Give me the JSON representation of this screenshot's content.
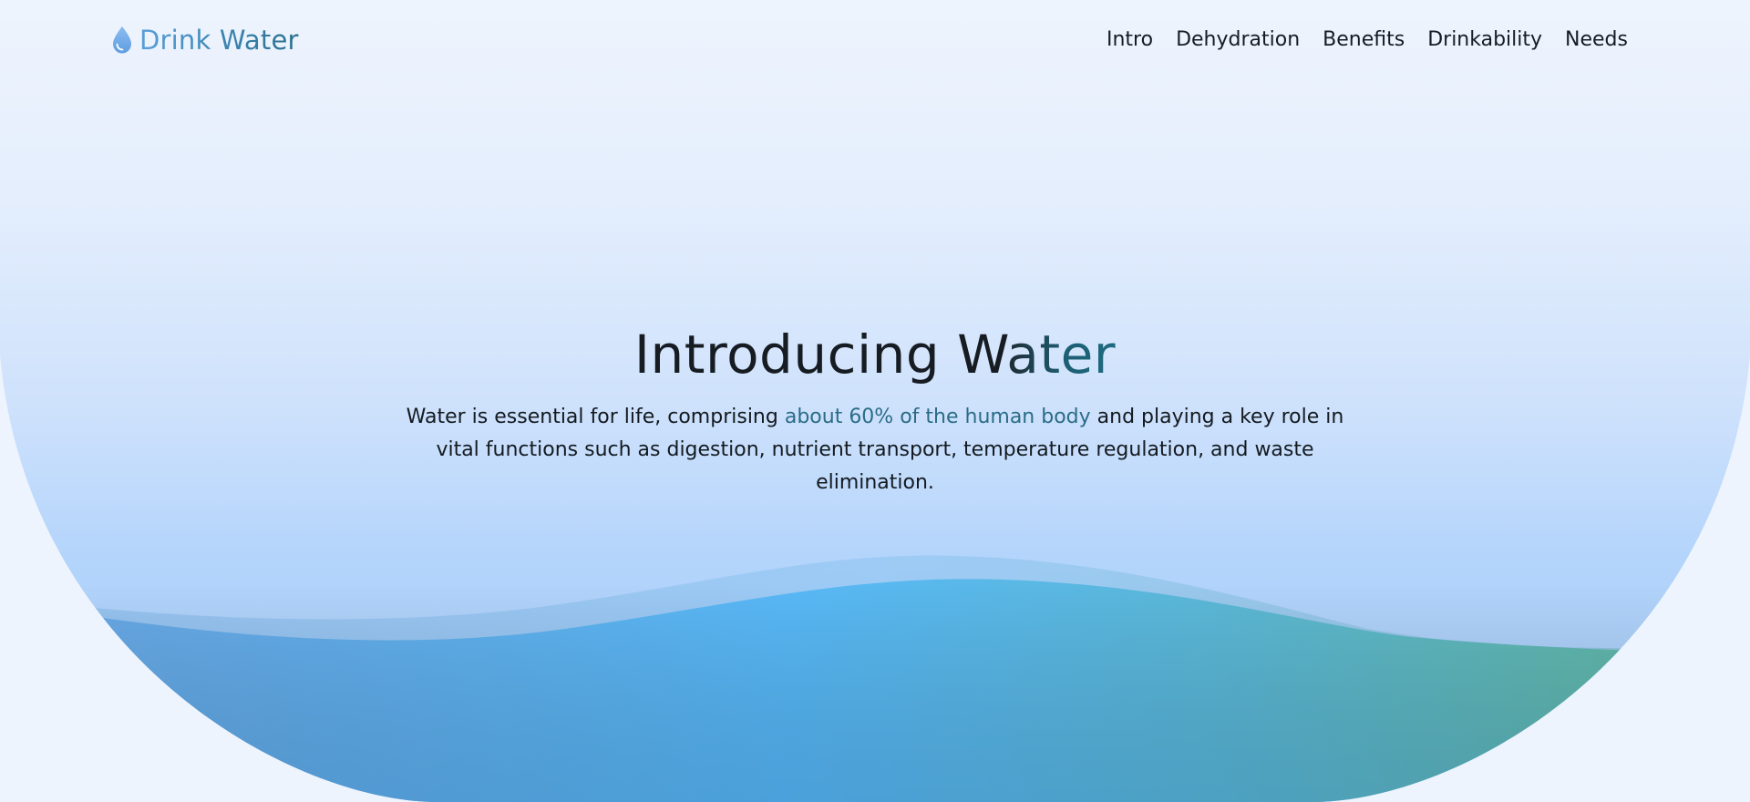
{
  "brand": {
    "icon": "water-drop-icon",
    "name": "Drink Water"
  },
  "nav": {
    "items": [
      {
        "label": "Intro"
      },
      {
        "label": "Dehydration"
      },
      {
        "label": "Benefits"
      },
      {
        "label": "Drinkability"
      },
      {
        "label": "Needs"
      }
    ]
  },
  "hero": {
    "title_part1": "Introducing W",
    "title_part2": "ater",
    "text_before": "Water is essential for life, comprising ",
    "text_highlight": "about 60% of the human body",
    "text_after": " and playing a key role in vital functions such as digestion, nutrient transport, temperature regulation, and waste elimination."
  },
  "colors": {
    "page_background": "#eef4fd",
    "hero_top": "#e9f2fe",
    "hero_bottom": "#a9cdfb",
    "wave_blue": "#58b8f6",
    "wave_green": "#57b6a0",
    "accent_text": "#2a6c88"
  }
}
